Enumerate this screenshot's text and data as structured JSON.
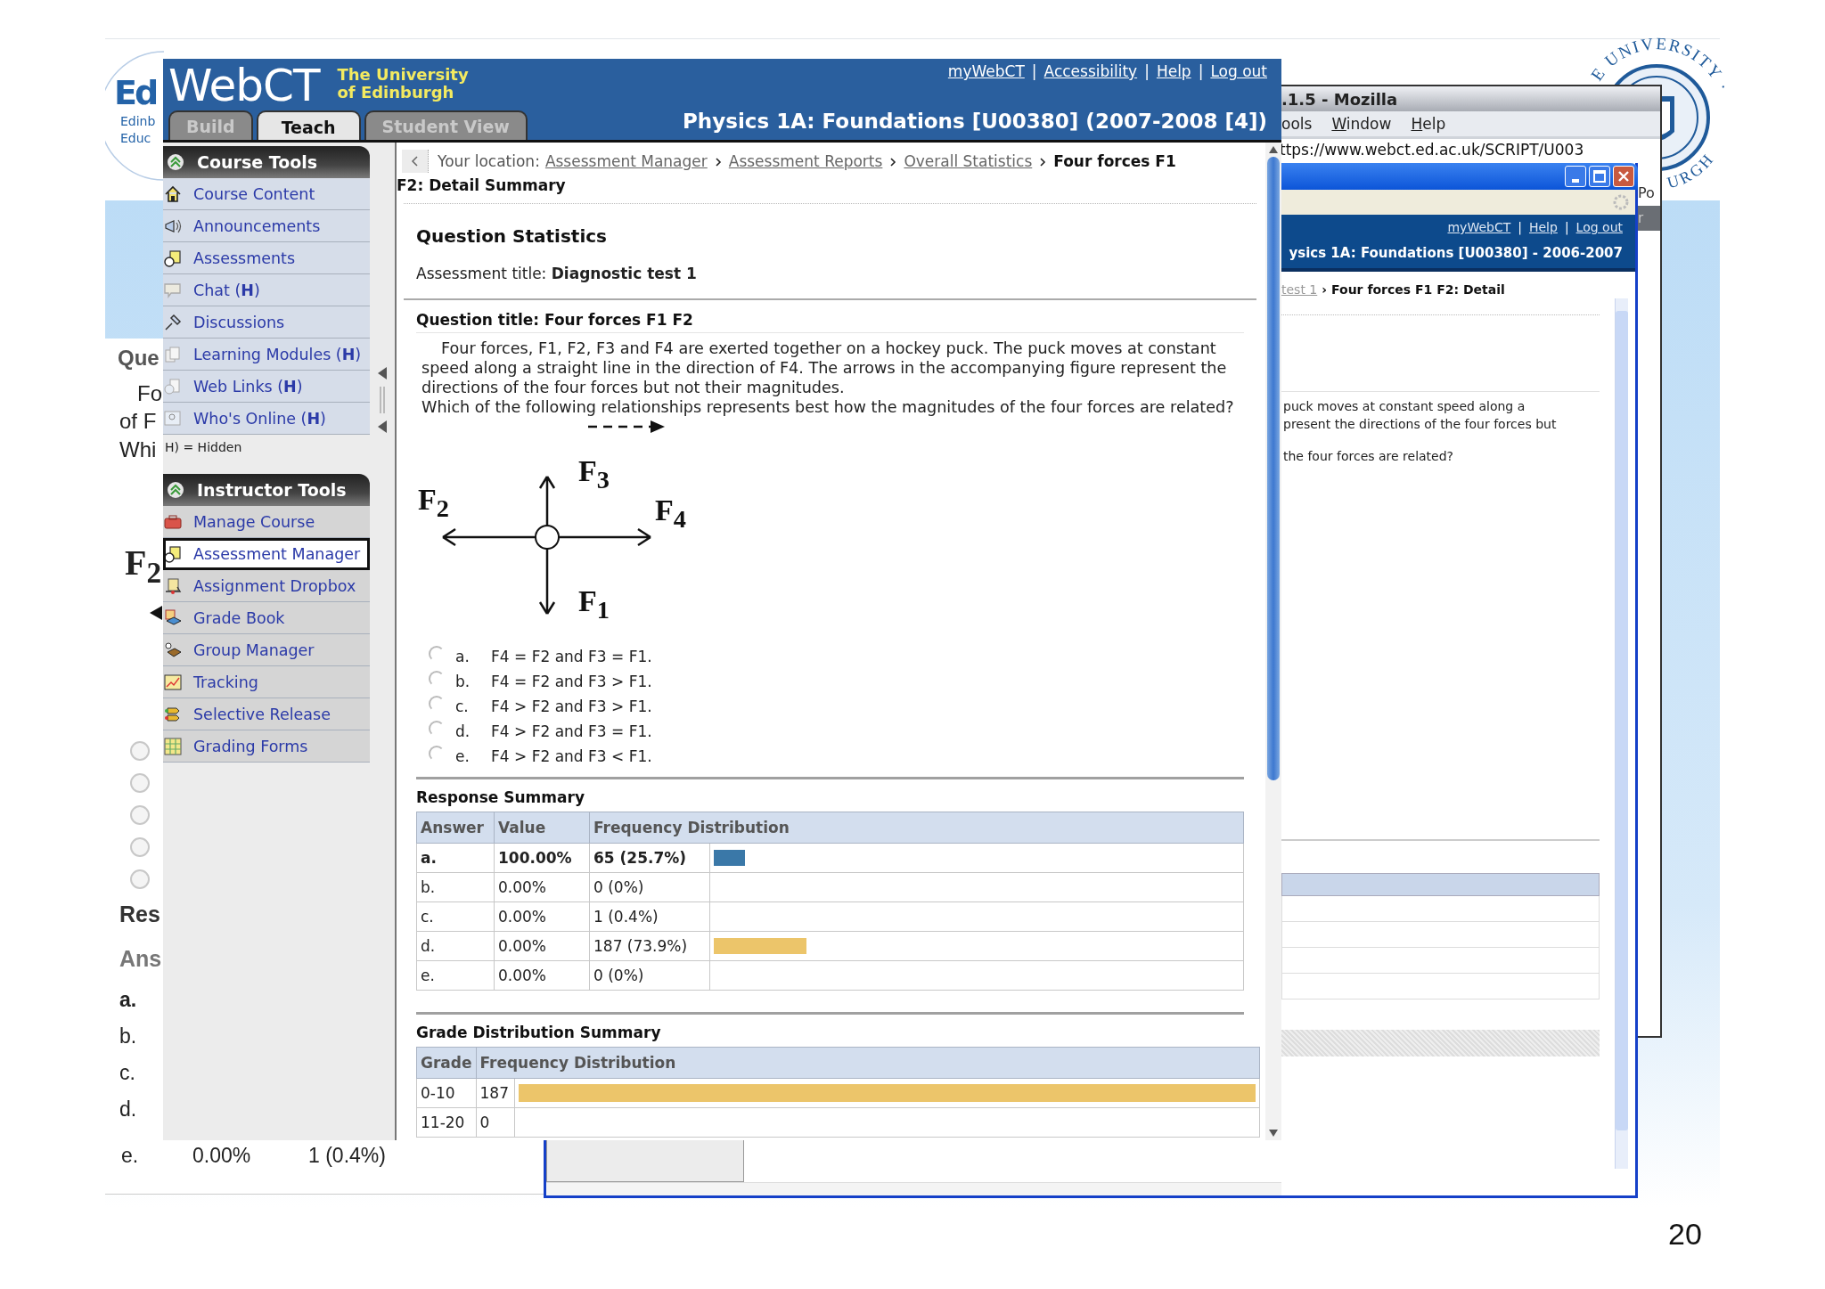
{
  "slide": {
    "page_number": "20",
    "logo": {
      "big": "Ed",
      "lines": [
        "Edinb",
        "Educ"
      ]
    },
    "crest": {
      "top_text": "E UNIVERSITY ·",
      "side_text": "URGH"
    }
  },
  "back_window_left": {
    "lines": [
      "Que",
      "Fo",
      "of F",
      "Whi"
    ],
    "figure_label": "F$_{2}$",
    "radios": [
      {
        "selected": false
      },
      {
        "selected": false
      },
      {
        "selected": false
      },
      {
        "selected": false
      },
      {
        "selected": false
      }
    ],
    "section": "Res",
    "table_header": "Ans",
    "rows": [
      "a.",
      "b.",
      "c.",
      "d."
    ],
    "last_row": [
      "e.",
      "0.00%",
      "1 (0.4%)"
    ]
  },
  "mozilla_window": {
    "title": ".1.5 - Mozilla",
    "menu": [
      {
        "label": "ools",
        "underline_first": false
      },
      {
        "label": "Window",
        "underline_first": true
      },
      {
        "label": "Help",
        "underline_first": true
      }
    ],
    "url": "ttps://www.webct.ed.ac.uk/SCRIPT/U003",
    "toolbar_texts": [
      "Po",
      "r"
    ]
  },
  "xp_window": {
    "links": [
      "myWebCT",
      "Help",
      "Log out"
    ],
    "separator": "|",
    "course_title": "ysics 1A: Foundations [U00380] - 2006-2007",
    "breadcrumb_link": "test 1",
    "breadcrumb_arrow": "›",
    "breadcrumb_current": "Four forces F1 F2: Detail",
    "text_lines": [
      "puck moves at constant speed along a",
      "present the directions of the four forces but",
      "the four forces are related?"
    ]
  },
  "main_window": {
    "brand": "WebCT",
    "institution": [
      "The University",
      "of Edinburgh"
    ],
    "top_links": [
      "myWebCT",
      "Accessibility",
      "Help",
      "Log out"
    ],
    "link_separator": "|",
    "tabs": [
      {
        "label": "Build",
        "selected": false
      },
      {
        "label": "Teach",
        "selected": true
      },
      {
        "label": "Student View",
        "selected": false
      }
    ],
    "course_title": "Physics 1A: Foundations [U00380] (2007-2008 [4])",
    "sidebar": {
      "sections": [
        {
          "title": "Course Tools",
          "items": [
            {
              "label": "Course Content",
              "selected": false
            },
            {
              "label": "Announcements",
              "selected": false
            },
            {
              "label": "Assessments",
              "selected": false
            },
            {
              "label": "Chat (**H**)",
              "selected": false
            },
            {
              "label": "Discussions",
              "selected": false
            },
            {
              "label": "Learning Modules (**H**)",
              "selected": false
            },
            {
              "label": "Web Links (**H**)",
              "selected": false
            },
            {
              "label": "Who's Online (**H**)",
              "selected": false
            }
          ],
          "legend": "H) = Hidden"
        },
        {
          "title": "Instructor Tools",
          "items": [
            {
              "label": "Manage Course",
              "selected": false
            },
            {
              "label": "Assessment Manager",
              "selected": true
            },
            {
              "label": "Assignment Dropbox",
              "selected": false
            },
            {
              "label": "Grade Book",
              "selected": false
            },
            {
              "label": "Group Manager",
              "selected": false
            },
            {
              "label": "Tracking",
              "selected": false
            },
            {
              "label": "Selective Release",
              "selected": false
            },
            {
              "label": "Grading Forms",
              "selected": false
            }
          ]
        }
      ]
    },
    "breadcrumb": {
      "label": "Your location:",
      "links": [
        "Assessment Manager",
        "Assessment Reports",
        "Overall Statistics"
      ],
      "current_lines": [
        "Four forces F1",
        "F2: Detail Summary"
      ]
    },
    "heading": "Question Statistics",
    "assessment": {
      "label": "Assessment title:",
      "value": "Diagnostic test 1"
    },
    "question_title": "Question title: Four forces F1 F2",
    "question_text": [
      "Four forces, F1, F2, F3 and F4 are exerted together on a hockey puck. The puck moves at constant speed along a straight line in the direction of F4. The arrows in the accompanying figure represent the directions of the four forces but not their magnitudes.",
      "Which of the following relationships represents best how the magnitudes of the four forces are related?"
    ],
    "figure": {
      "labels": [
        "F$_{3}$",
        "F$_{2}$",
        "F$_{4}$",
        "F$_{1}$"
      ]
    },
    "options": [
      {
        "letter": "a.",
        "text": "F4 = F2 and F3 = F1.",
        "selected": false
      },
      {
        "letter": "b.",
        "text": "F4 = F2 and F3 > F1.",
        "selected": false
      },
      {
        "letter": "c.",
        "text": "F4 > F2 and F3 > F1.",
        "selected": false
      },
      {
        "letter": "d.",
        "text": "F4 > F2 and F3 = F1.",
        "selected": false
      },
      {
        "letter": "e.",
        "text": "F4 > F2 and F3 < F1.",
        "selected": false
      }
    ],
    "response_summary": {
      "title": "Response Summary",
      "columns": [
        "Answer",
        "Value",
        "Frequency Distribution"
      ],
      "rows": [
        {
          "answer": "a.",
          "value": "100.00%",
          "frequency": "65 (25.7%)",
          "correct": true,
          "level": 0.06,
          "color": "#3a78a8"
        },
        {
          "answer": "b.",
          "value": "0.00%",
          "frequency": "0 (0%)",
          "correct": false
        },
        {
          "answer": "c.",
          "value": "0.00%",
          "frequency": "1 (0.4%)",
          "correct": false
        },
        {
          "answer": "d.",
          "value": "0.00%",
          "frequency": "187 (73.9%)",
          "correct": false,
          "level": 0.176,
          "color": "#ecc56a"
        },
        {
          "answer": "e.",
          "value": "0.00%",
          "frequency": "0 (0%)",
          "correct": false
        }
      ]
    },
    "grade_distribution": {
      "title": "Grade Distribution Summary",
      "columns": [
        "Grade",
        "Frequency Distribution"
      ],
      "rows": [
        {
          "grade": "0-10",
          "count": "187",
          "level": 1,
          "color": "#ecc56a"
        },
        {
          "grade": "11-20",
          "count": "0"
        }
      ]
    }
  }
}
